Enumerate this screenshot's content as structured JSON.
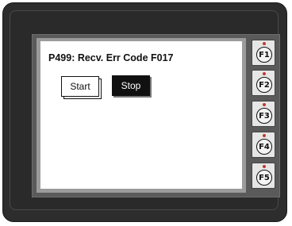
{
  "screen": {
    "message": "P499: Recv. Err Code F017",
    "start_label": "Start",
    "stop_label": "Stop"
  },
  "function_keys": [
    {
      "label": "F1"
    },
    {
      "label": "F2"
    },
    {
      "label": "F3"
    },
    {
      "label": "F4"
    },
    {
      "label": "F5"
    }
  ],
  "colors": {
    "bezel": "#2d2d2d",
    "led": "#c0392b",
    "stop_button_bg": "#111111"
  }
}
